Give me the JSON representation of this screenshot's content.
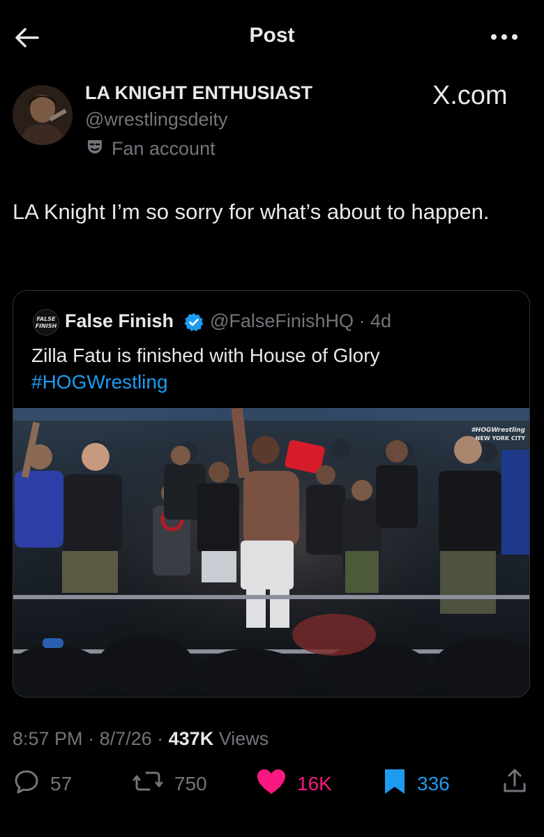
{
  "header": {
    "title": "Post"
  },
  "author": {
    "name": "LA KNIGHT ENTHUSIAST",
    "handle": "@wrestlingsdeity",
    "label": "Fan account"
  },
  "brand_watermark": "X.com",
  "tweet_text": "LA Knight I’m so sorry for what’s about to happen.",
  "quoted": {
    "logo_text": "FALSE FINISH",
    "name": "False Finish",
    "handle": "@FalseFinishHQ",
    "age": "4d",
    "text": "Zilla Fatu is finished with House of Glory",
    "hashtag": "#HOGWrestling",
    "media_overlay_line1": "#HOGWrestling",
    "media_overlay_line2": "NEW YORK CITY"
  },
  "meta": {
    "time": "8:57 PM",
    "date": "8/7/26",
    "views_count": "437K",
    "views_label": "Views"
  },
  "actions": {
    "replies": "57",
    "reposts": "750",
    "likes": "16K",
    "bookmarks": "336"
  },
  "colors": {
    "background": "#000000",
    "primary_text": "#e7e9ea",
    "secondary_text": "#71767b",
    "link": "#1d9bf0",
    "like_pink": "#f91880",
    "bookmark_blue": "#1d9bf0"
  }
}
